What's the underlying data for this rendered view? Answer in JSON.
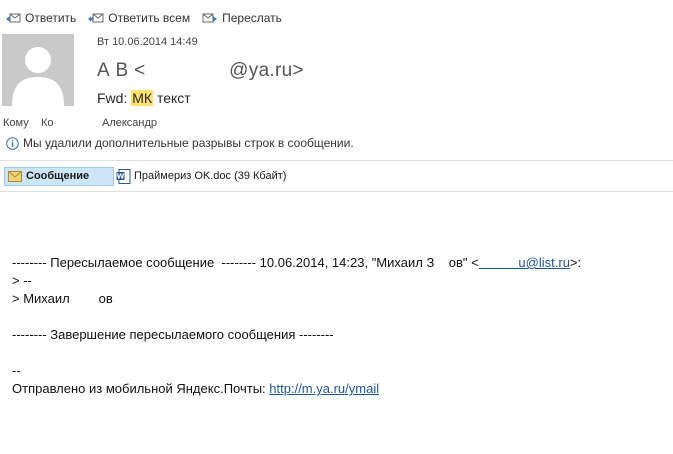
{
  "toolbar": {
    "reply": "Ответить",
    "reply_all": "Ответить всем",
    "forward": "Переслать"
  },
  "header": {
    "date": "Вт 10.06.2014 14:49",
    "sender": "А В <               @ya.ru>",
    "subject_prefix": "Fwd: ",
    "subject_highlight": "МК",
    "subject_rest": " текст",
    "to_label": "Кому",
    "to_value": "Ко",
    "to_name": "Александр",
    "info": "Мы удалили дополнительные разрывы строк в сообщении."
  },
  "attachments": {
    "message_tab": "Сообщение",
    "file": "Праймериз OK.doc (39 Кбайт)"
  },
  "body": {
    "line1_prefix": "-------- Пересылаемое сообщение  -------- 10.06.2014, 14:23, \"Михаил З    ов\" <",
    "line1_link": "           u@list.ru",
    "line1_suffix": ">:",
    "line2": "> --",
    "line3": "> Михаил        ов",
    "line4": "-------- Завершение пересылаемого сообщения --------",
    "line5": "--",
    "line6_prefix": "Отправлено из мобильной Яндекс.Почты: ",
    "line6_link": "http://m.ya.ru/ymail"
  },
  "colors": {
    "highlight": "#ffe26b",
    "link": "#1e56a0",
    "selected_tab": "#cde6f7"
  }
}
